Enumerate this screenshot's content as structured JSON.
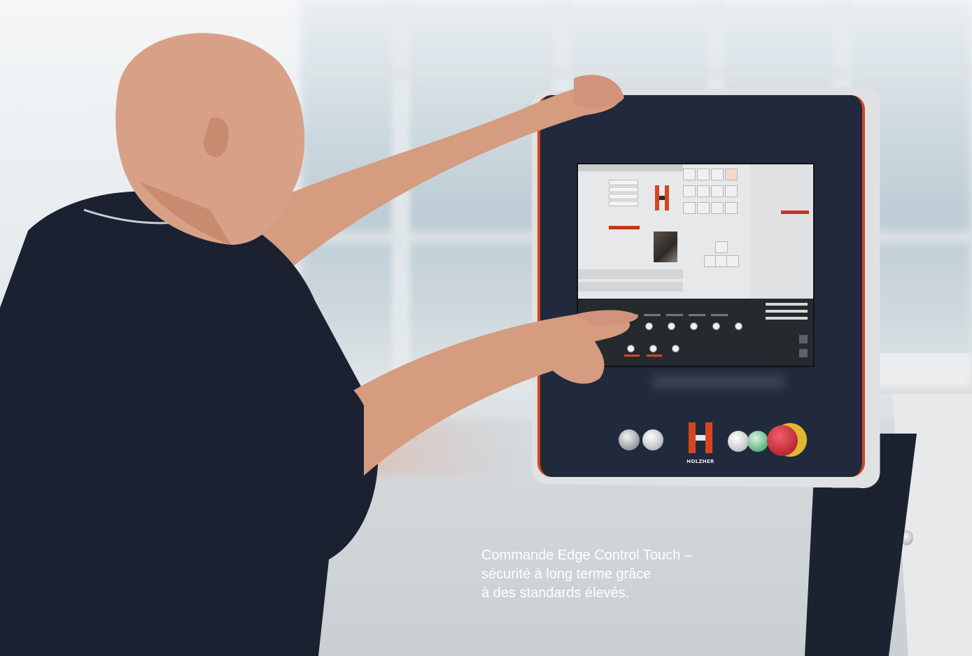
{
  "caption": {
    "line1": "Commande Edge Control Touch –",
    "line2": "sécurité à long terme grâce",
    "line3": "à des standards élevés."
  },
  "console": {
    "logo_text": "HOLZHER",
    "accent_color": "#d4471e",
    "body_color": "#212a3d"
  },
  "colors": {
    "shirt": "#1b2130",
    "skin": "#d9a389",
    "background": "#dfe6ea"
  }
}
